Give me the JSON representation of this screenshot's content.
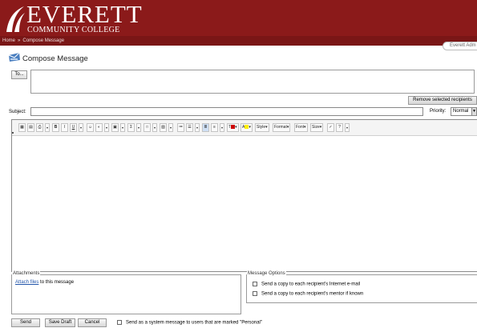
{
  "header": {
    "logo_name": "EVERETT",
    "logo_sub": "COMMUNITY COLLEGE",
    "logo_icon": "college-logo-mark",
    "brand_color": "#8b1a1a"
  },
  "breadcrumb": {
    "home": "Home",
    "separator": "»",
    "current": "Compose Message"
  },
  "user_tab": "Everett Adm",
  "page": {
    "title": "Compose Message",
    "title_icon": "compose-envelope-icon"
  },
  "recipients": {
    "to_label": "To...",
    "value": "",
    "remove_label": "Remove selected recipients"
  },
  "subject": {
    "label": "Subject:",
    "value": ""
  },
  "priority": {
    "label": "Priority:",
    "selected": "Normal"
  },
  "toolbar": {
    "text_items": {
      "style": "Style",
      "format": "Format",
      "font": "Font",
      "size": "Size"
    },
    "buttons": [
      "insert-table-icon",
      "save-icon",
      "print-icon",
      "bold-icon",
      "italic-icon",
      "underline-icon",
      "emoticon-icon",
      "image-icon",
      "picture-icon",
      "symbol-icon",
      "box-icon",
      "media-icon",
      "ordered-list-icon",
      "unordered-list-icon",
      "align-icon",
      "justify-icon",
      "font-color-icon",
      "highlight-color-icon",
      "spellcheck-icon",
      "help-icon"
    ],
    "font_color": "#cc0000",
    "highlight_color": "#ffee00"
  },
  "editor": {
    "content": ""
  },
  "attachments": {
    "legend": "Attachments",
    "link": "Attach files",
    "suffix": " to this message"
  },
  "message_options": {
    "legend": "Message Options",
    "opt1": "Send a copy to each recipient's Internet e-mail",
    "opt2": "Send a copy to each recipient's mentor if known",
    "opt1_checked": false,
    "opt2_checked": false
  },
  "actions": {
    "send": "Send",
    "save_draft": "Save Draft",
    "cancel": "Cancel",
    "system_message": "Send as a system message to users that are marked \"Personal\"",
    "system_message_checked": false
  }
}
